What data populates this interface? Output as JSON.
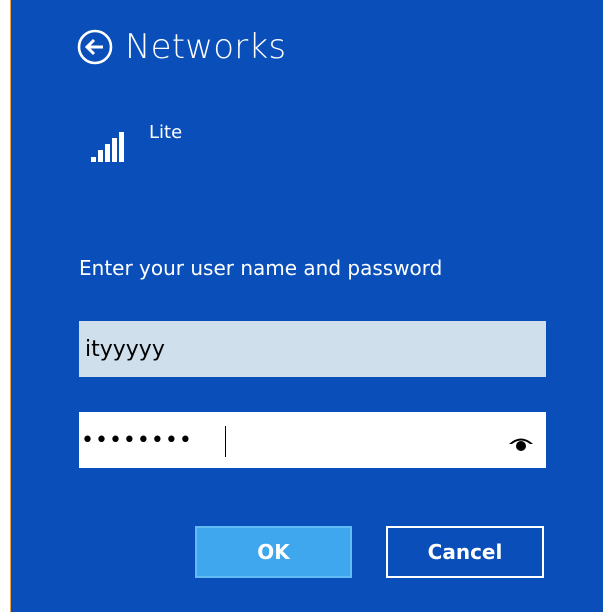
{
  "header": {
    "title": "Networks",
    "back_icon": "back-arrow-circle-icon"
  },
  "network": {
    "name": "Lite",
    "signal_icon": "wifi-signal-bars-icon"
  },
  "form": {
    "prompt": "Enter your user name and password",
    "username_value": "ityyyyy",
    "password_masked": "••••••••",
    "reveal_icon": "eye-icon"
  },
  "buttons": {
    "ok_label": "OK",
    "cancel_label": "Cancel"
  },
  "colors": {
    "background": "#0a4fb9",
    "ok_button": "#3ea7ee",
    "username_field": "#cfe0ec",
    "password_field": "#ffffff",
    "text": "#ffffff"
  }
}
